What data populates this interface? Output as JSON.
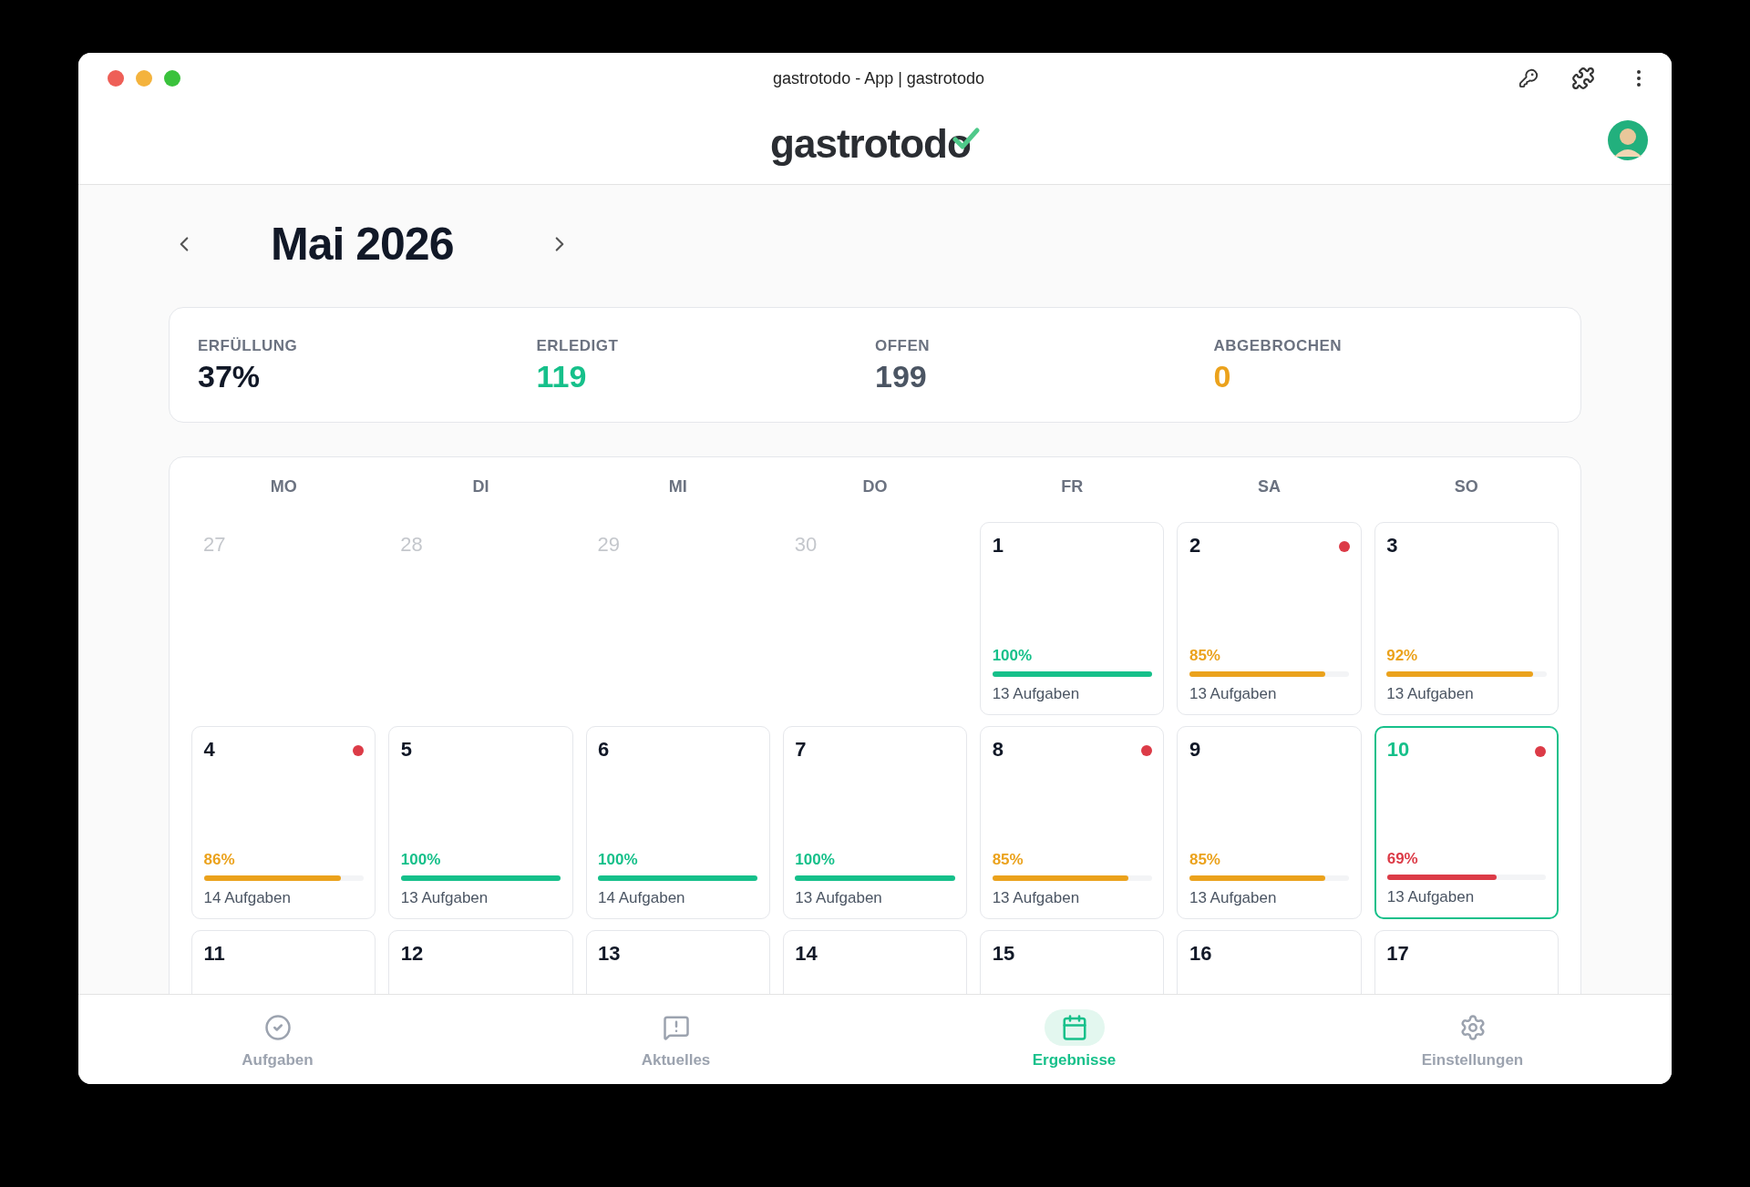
{
  "window": {
    "title": "gastrotodo - App | gastrotodo"
  },
  "header": {
    "logo": "gastrotodo"
  },
  "month": {
    "title": "Mai 2026"
  },
  "stats": [
    {
      "label": "ERFÜLLUNG",
      "value": "37%",
      "color": "#111827"
    },
    {
      "label": "ERLEDIGT",
      "value": "119",
      "color": "#16c08a"
    },
    {
      "label": "OFFEN",
      "value": "199",
      "color": "#4b5563"
    },
    {
      "label": "ABGEBROCHEN",
      "value": "0",
      "color": "#eba21c"
    }
  ],
  "weekdays": [
    "MO",
    "DI",
    "MI",
    "DO",
    "FR",
    "SA",
    "SO"
  ],
  "days": [
    {
      "day": "27",
      "in_month": false
    },
    {
      "day": "28",
      "in_month": false
    },
    {
      "day": "29",
      "in_month": false
    },
    {
      "day": "30",
      "in_month": false
    },
    {
      "day": "1",
      "in_month": true,
      "selected": false,
      "alert": false,
      "percent": "100%",
      "level": 1,
      "color": "#16c08a",
      "tasks": "13 Aufgaben"
    },
    {
      "day": "2",
      "in_month": true,
      "selected": false,
      "alert": true,
      "percent": "85%",
      "level": 0.85,
      "color": "#eba21c",
      "tasks": "13 Aufgaben"
    },
    {
      "day": "3",
      "in_month": true,
      "selected": false,
      "alert": false,
      "percent": "92%",
      "level": 0.92,
      "color": "#eba21c",
      "tasks": "13 Aufgaben"
    },
    {
      "day": "4",
      "in_month": true,
      "selected": false,
      "alert": true,
      "percent": "86%",
      "level": 0.86,
      "color": "#eba21c",
      "tasks": "14 Aufgaben"
    },
    {
      "day": "5",
      "in_month": true,
      "selected": false,
      "alert": false,
      "percent": "100%",
      "level": 1,
      "color": "#16c08a",
      "tasks": "13 Aufgaben"
    },
    {
      "day": "6",
      "in_month": true,
      "selected": false,
      "alert": false,
      "percent": "100%",
      "level": 1,
      "color": "#16c08a",
      "tasks": "14 Aufgaben"
    },
    {
      "day": "7",
      "in_month": true,
      "selected": false,
      "alert": false,
      "percent": "100%",
      "level": 1,
      "color": "#16c08a",
      "tasks": "13 Aufgaben"
    },
    {
      "day": "8",
      "in_month": true,
      "selected": false,
      "alert": true,
      "percent": "85%",
      "level": 0.85,
      "color": "#eba21c",
      "tasks": "13 Aufgaben"
    },
    {
      "day": "9",
      "in_month": true,
      "selected": false,
      "alert": false,
      "percent": "85%",
      "level": 0.85,
      "color": "#eba21c",
      "tasks": "13 Aufgaben"
    },
    {
      "day": "10",
      "in_month": true,
      "selected": true,
      "alert": true,
      "percent": "69%",
      "level": 0.69,
      "color": "#dc3b47",
      "tasks": "13 Aufgaben"
    },
    {
      "day": "11",
      "in_month": true,
      "selected": false,
      "alert": false
    },
    {
      "day": "12",
      "in_month": true,
      "selected": false,
      "alert": false
    },
    {
      "day": "13",
      "in_month": true,
      "selected": false,
      "alert": false
    },
    {
      "day": "14",
      "in_month": true,
      "selected": false,
      "alert": false
    },
    {
      "day": "15",
      "in_month": true,
      "selected": false,
      "alert": false
    },
    {
      "day": "16",
      "in_month": true,
      "selected": false,
      "alert": false
    },
    {
      "day": "17",
      "in_month": true,
      "selected": false,
      "alert": false
    }
  ],
  "nav": [
    {
      "label": "Aufgaben",
      "kind": "tasks",
      "selected": false
    },
    {
      "label": "Aktuelles",
      "kind": "news",
      "selected": false
    },
    {
      "label": "Ergebnisse",
      "kind": "results",
      "selected": true
    },
    {
      "label": "Einstellungen",
      "kind": "settings",
      "selected": false
    }
  ]
}
